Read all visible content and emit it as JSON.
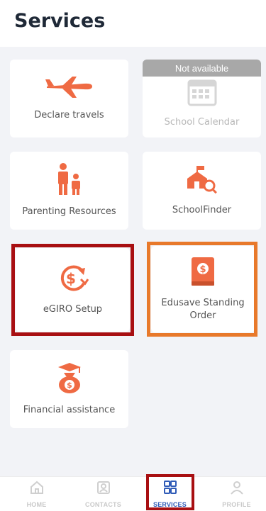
{
  "header": {
    "title": "Services"
  },
  "services": {
    "declare_travels": "Declare travels",
    "school_calendar": "School Calendar",
    "school_calendar_badge": "Not available",
    "parenting_resources": "Parenting Resources",
    "schoolfinder": "SchoolFinder",
    "egiro_setup": "eGIRO Setup",
    "edusave_line1": "Edusave Standing",
    "edusave_line2": "Order",
    "financial_assistance": "Financial assistance"
  },
  "nav": {
    "home": "HOME",
    "contacts": "CONTACTS",
    "services": "SERVICES",
    "profile": "PROFILE"
  },
  "colors": {
    "accent": "#ef6a43",
    "active_nav": "#2f5bb7",
    "highlight_red": "#a80f12",
    "highlight_orange": "#e8792b"
  }
}
